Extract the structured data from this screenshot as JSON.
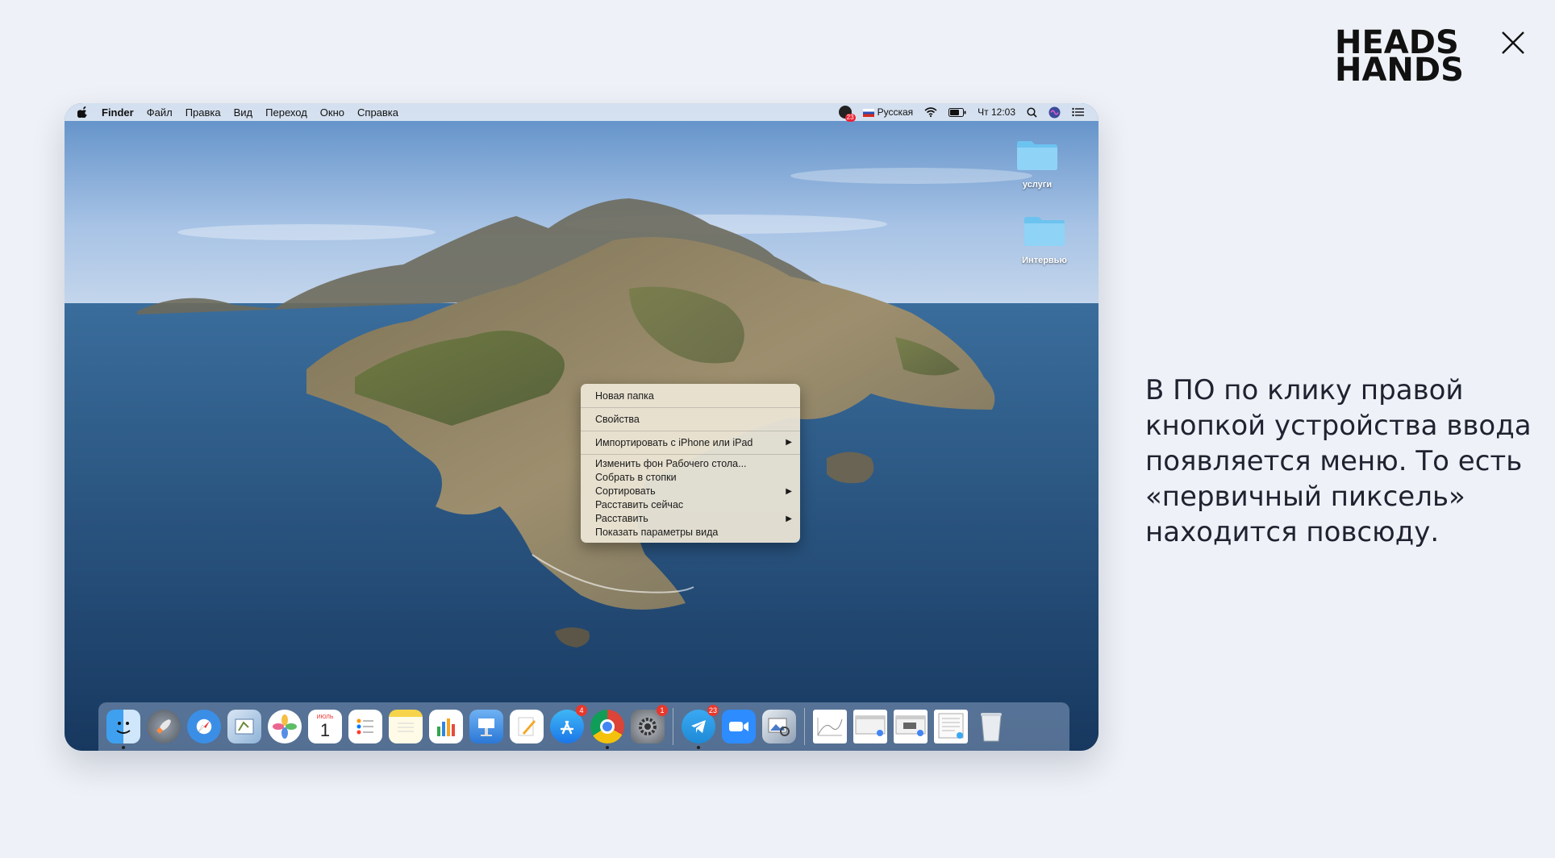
{
  "logo": {
    "line1": "HEADS",
    "line2": "HANDS"
  },
  "caption": "В ПО по клику правой кнопкой устройства ввода появляется меню. То есть «первичный пиксель» находится повсюду.",
  "menubar": {
    "app": "Finder",
    "items": [
      "Файл",
      "Правка",
      "Вид",
      "Переход",
      "Окно",
      "Справка"
    ],
    "notification_count": "23",
    "input_source": "Русская",
    "clock": "Чт 12:03"
  },
  "desktop": {
    "folders": [
      {
        "label": "услуги"
      },
      {
        "label": "Интервью"
      }
    ]
  },
  "context_menu": {
    "new_folder": "Новая папка",
    "properties": "Свойства",
    "import": "Импортировать с iPhone или iPad",
    "change_bg": "Изменить фон Рабочего стола...",
    "stacks": "Собрать в стопки",
    "sort": "Сортировать",
    "arrange_now": "Расставить сейчас",
    "arrange": "Расставить",
    "view_options": "Показать параметры вида"
  },
  "dock": {
    "calendar_month": "ИЮЛЬ",
    "calendar_day": "1",
    "appstore_badge": "4",
    "settings_badge": "1",
    "telegram_badge": "23"
  },
  "colors": {
    "folder": "#6cc3f0",
    "badge": "#e8372c",
    "menu_bg": "#ece6d6"
  }
}
